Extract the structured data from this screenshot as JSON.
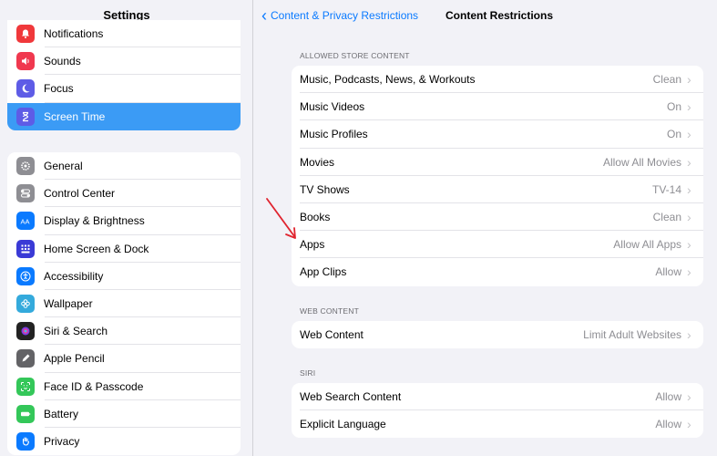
{
  "sidebar": {
    "title": "Settings",
    "group1": [
      {
        "label": "Notifications",
        "icon": "bell-icon",
        "color": "#f0383b"
      },
      {
        "label": "Sounds",
        "icon": "speaker-icon",
        "color": "#f0384f"
      },
      {
        "label": "Focus",
        "icon": "moon-icon",
        "color": "#5e5ce6"
      },
      {
        "label": "Screen Time",
        "icon": "hourglass-icon",
        "color": "#5e5ce6",
        "selected": true
      }
    ],
    "group2": [
      {
        "label": "General",
        "icon": "gear-icon",
        "color": "#8e8e93"
      },
      {
        "label": "Control Center",
        "icon": "toggles-icon",
        "color": "#8e8e93"
      },
      {
        "label": "Display & Brightness",
        "icon": "text-size-icon",
        "color": "#0a7aff"
      },
      {
        "label": "Home Screen & Dock",
        "icon": "grid-icon",
        "color": "#3a3ad6"
      },
      {
        "label": "Accessibility",
        "icon": "accessibility-icon",
        "color": "#0a7aff"
      },
      {
        "label": "Wallpaper",
        "icon": "flower-icon",
        "color": "#34aadc"
      },
      {
        "label": "Siri & Search",
        "icon": "siri-icon",
        "color": "#222222"
      },
      {
        "label": "Apple Pencil",
        "icon": "pencil-icon",
        "color": "#636366"
      },
      {
        "label": "Face ID & Passcode",
        "icon": "faceid-icon",
        "color": "#34c759"
      },
      {
        "label": "Battery",
        "icon": "battery-icon",
        "color": "#34c759"
      },
      {
        "label": "Privacy",
        "icon": "hand-icon",
        "color": "#0a7aff"
      }
    ]
  },
  "main": {
    "back_label": "Content & Privacy Restrictions",
    "title": "Content Restrictions",
    "sections": [
      {
        "header": "ALLOWED STORE CONTENT",
        "rows": [
          {
            "label": "Music, Podcasts, News, & Workouts",
            "value": "Clean"
          },
          {
            "label": "Music Videos",
            "value": "On"
          },
          {
            "label": "Music Profiles",
            "value": "On"
          },
          {
            "label": "Movies",
            "value": "Allow All Movies"
          },
          {
            "label": "TV Shows",
            "value": "TV-14"
          },
          {
            "label": "Books",
            "value": "Clean"
          },
          {
            "label": "Apps",
            "value": "Allow All Apps"
          },
          {
            "label": "App Clips",
            "value": "Allow"
          }
        ]
      },
      {
        "header": "WEB CONTENT",
        "rows": [
          {
            "label": "Web Content",
            "value": "Limit Adult Websites"
          }
        ]
      },
      {
        "header": "SIRI",
        "rows": [
          {
            "label": "Web Search Content",
            "value": "Allow"
          },
          {
            "label": "Explicit Language",
            "value": "Allow"
          }
        ]
      }
    ]
  },
  "annotation": {
    "color": "#e0242f",
    "icon": "red-arrow-icon"
  },
  "accent": "#0a7aff"
}
